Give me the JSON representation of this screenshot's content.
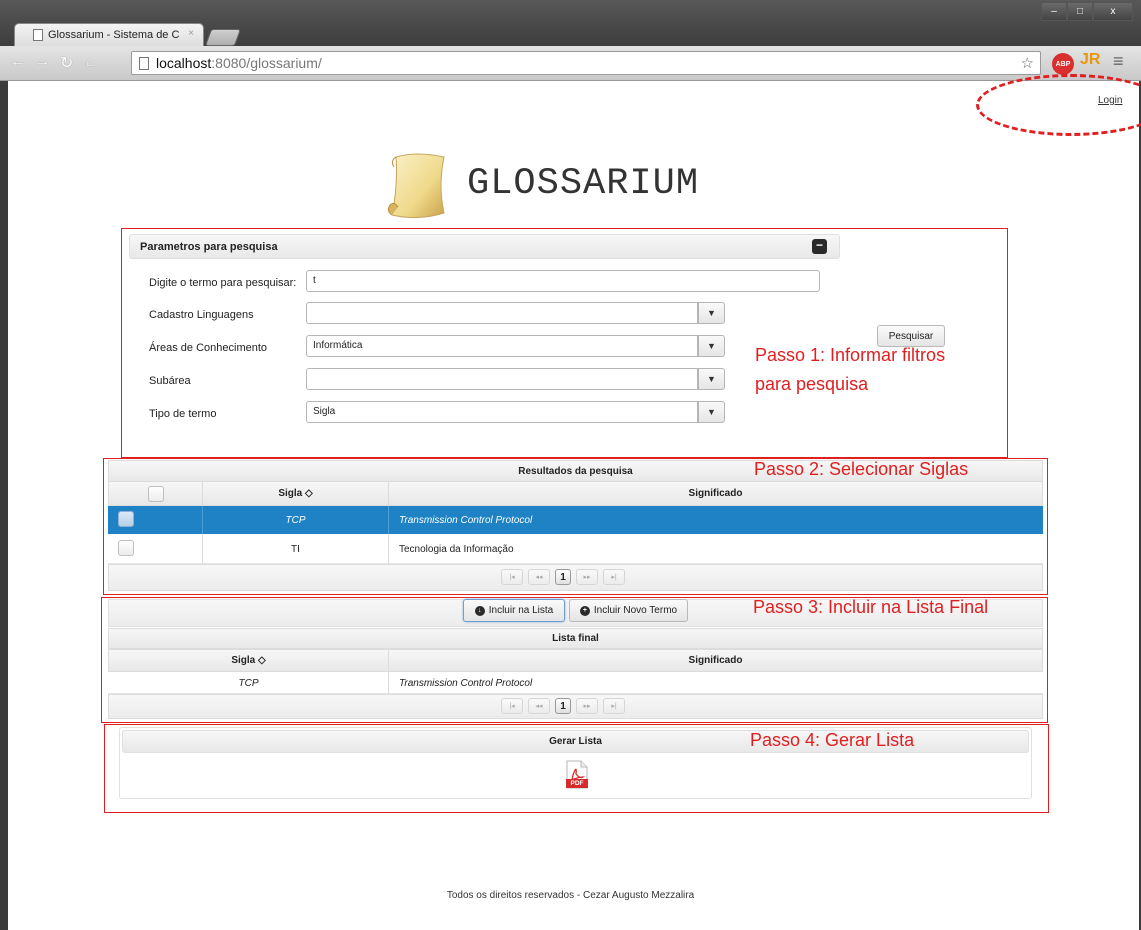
{
  "browser": {
    "tab_title": "Glossarium - Sistema de C",
    "tab_close": "×",
    "url_host": "localhost",
    "url_path": ":8080/glossarium/",
    "window_controls": [
      "–",
      "□",
      "x"
    ],
    "ext_abp": "ABP",
    "ext_jr": "JR"
  },
  "header": {
    "login": "Login",
    "app_title": "GLOSSARIUM"
  },
  "search_panel": {
    "title": "Parametros para pesquisa",
    "collapse": "−",
    "fields": [
      {
        "label": "Digite o termo para pesquisar:",
        "value": "t"
      },
      {
        "label": "Cadastro Linguagens",
        "value": ""
      },
      {
        "label": "Áreas de Conhecimento",
        "value": "Informática"
      },
      {
        "label": "Subárea",
        "value": ""
      },
      {
        "label": "Tipo de termo",
        "value": "Sigla"
      }
    ],
    "search_button": "Pesquisar"
  },
  "annotations": {
    "step1_line1": "Passo 1: Informar filtros",
    "step1_line2": "para pesquisa",
    "step2": "Passo 2: Selecionar Siglas",
    "step3": "Passo 3: Incluir na Lista Final",
    "step4": "Passo 4: Gerar Lista"
  },
  "results": {
    "title": "Resultados da pesquisa",
    "col_sigla": "Sigla ◇",
    "col_significado": "Significado",
    "rows": [
      {
        "sigla": "TCP",
        "significado": "Transmission Control Protocol",
        "selected": true
      },
      {
        "sigla": "TI",
        "significado": "Tecnologia da Informação",
        "selected": false
      }
    ],
    "pager": {
      "first": "|◂",
      "prev": "◂◂",
      "page": "1",
      "next": "▸▸",
      "last": "▸|"
    }
  },
  "final_list": {
    "add_button": "Incluir na Lista",
    "add_new_button": "Incluir Novo Termo",
    "title": "Lista final",
    "col_sigla": "Sigla ◇",
    "col_significado": "Significado",
    "rows": [
      {
        "sigla": "TCP",
        "significado": "Transmission Control Protocol"
      }
    ],
    "pager": {
      "first": "|◂",
      "prev": "◂◂",
      "page": "1",
      "next": "▸▸",
      "last": "▸|"
    }
  },
  "generate": {
    "title": "Gerar Lista",
    "pdf_label": "PDF"
  },
  "footer": "Todos os direitos reservados - Cezar Augusto Mezzalira"
}
